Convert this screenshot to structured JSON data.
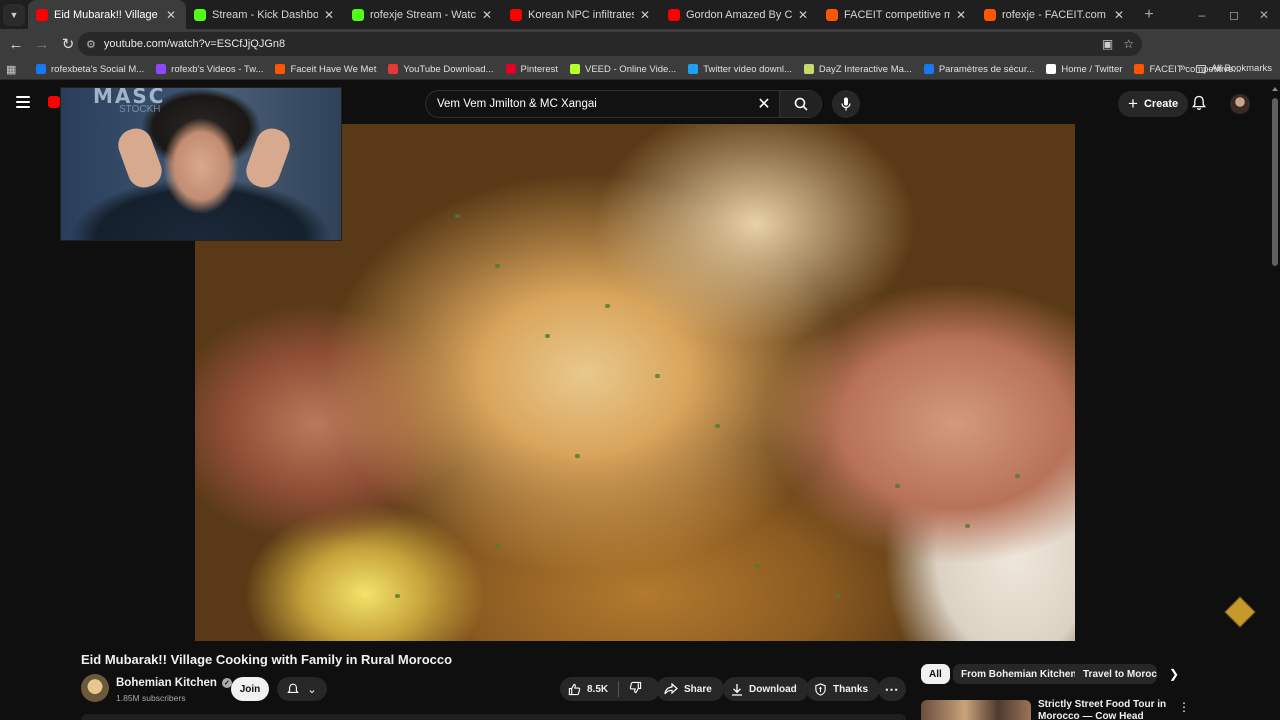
{
  "browser": {
    "tabs": [
      {
        "title": "Eid Mubarak!! Village Cooking",
        "favicon_color": "#ff0000",
        "active": true
      },
      {
        "title": "Stream - Kick Dashboard",
        "favicon_color": "#53fc18",
        "active": false
      },
      {
        "title": "rofexje Stream - Watch Live on",
        "favicon_color": "#53fc18",
        "active": false
      },
      {
        "title": "Korean NPC infiltrates Sony HQ",
        "favicon_color": "#ff0000",
        "active": false
      },
      {
        "title": "Gordon Amazed By Chef Who",
        "favicon_color": "#ff0000",
        "active": false
      },
      {
        "title": "FACEIT competitive match - FA",
        "favicon_color": "#ff5500",
        "active": false
      },
      {
        "title": "rofexje - FACEIT.com",
        "favicon_color": "#ff5500",
        "active": false
      }
    ],
    "url": "youtube.com/watch?v=ESCfJjQJGn8",
    "bookmarks": [
      {
        "label": "rofexbeta's Social M...",
        "color": "#1877f2"
      },
      {
        "label": "rofexb's Videos - Tw...",
        "color": "#9146ff"
      },
      {
        "label": "Faceit Have We Met",
        "color": "#ff5500"
      },
      {
        "label": "YouTube Download...",
        "color": "#e53935"
      },
      {
        "label": "Pinterest",
        "color": "#e60023"
      },
      {
        "label": "VEED - Online Vide...",
        "color": "#b8ff2e"
      },
      {
        "label": "Twitter video downl...",
        "color": "#1da1f2"
      },
      {
        "label": "DayZ Interactive Ma...",
        "color": "#c8d86a"
      },
      {
        "label": "Paramètres de sécur...",
        "color": "#1877f2"
      },
      {
        "label": "Home / Twitter",
        "color": "#ffffff"
      },
      {
        "label": "FACEIT competitive...",
        "color": "#ff5500"
      }
    ],
    "all_bookmarks": "All Bookmarks"
  },
  "youtube": {
    "search_query": "Vem Vem Jmilton & MC Xangai",
    "create_label": "Create",
    "video": {
      "title": "Eid Mubarak!! Village Cooking with Family in Rural Morocco",
      "channel": "Bohemian Kitchen",
      "subscribers": "1.85M subscribers",
      "join_label": "Join",
      "likes": "8.5K",
      "share_label": "Share",
      "download_label": "Download",
      "thanks_label": "Thanks"
    },
    "stream_overlay": {
      "text": "MASC",
      "subtext": "STOCKH"
    },
    "chips": [
      "All",
      "From Bohemian Kitchen",
      "Travel to Morocco"
    ],
    "related": [
      {
        "title": "Strictly Street Food Tour in Morocco — Cow Head"
      }
    ]
  }
}
